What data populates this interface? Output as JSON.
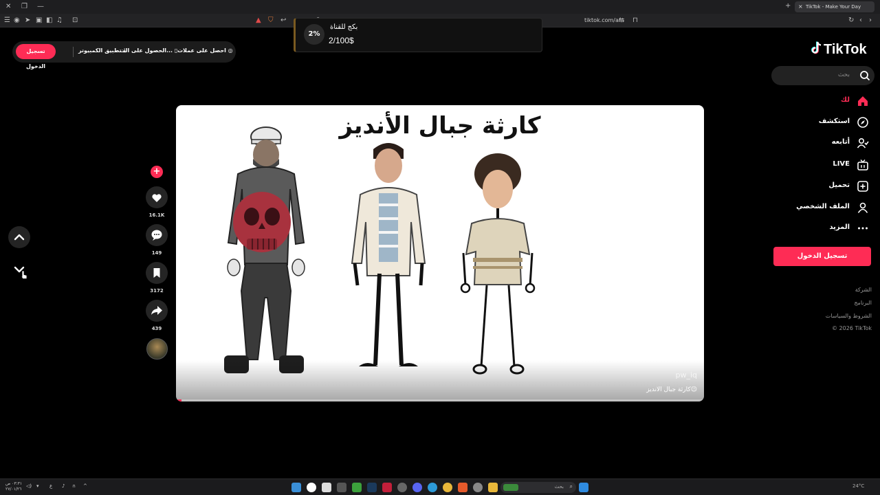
{
  "browser": {
    "tab_title": "TikTok - Make Your Day",
    "url": "tiktok.com/ar/",
    "tab_close": "×",
    "new_tab": "+",
    "window_controls": [
      "✕",
      "❐",
      "—"
    ]
  },
  "download_popup": {
    "percent": "2%",
    "title": "بكج للقناة",
    "amount": "2/100$"
  },
  "topbar": {
    "login": "تسجيل الدخول",
    "desktop_app": "تطبيق الكمبيوتر",
    "get_app": "الحصول على الت...",
    "coins": "احصل على عملات"
  },
  "sidebar": {
    "logo": "TikTok",
    "search_placeholder": "بحث",
    "items": [
      {
        "label": "لك",
        "icon": "home-icon"
      },
      {
        "label": "استكشف",
        "icon": "compass-icon"
      },
      {
        "label": "أتابعه",
        "icon": "user-follow-icon"
      },
      {
        "label": "LIVE",
        "icon": "live-tv-icon"
      },
      {
        "label": "تحميل",
        "icon": "upload-icon"
      },
      {
        "label": "الملف الشخصي",
        "icon": "profile-icon"
      },
      {
        "label": "المزيد",
        "icon": "more-icon"
      }
    ],
    "login_button": "تسجيل الدخول",
    "footer": [
      "الشركة",
      "البرنامج",
      "الشروط والسياسات",
      "© 2026 TikTok"
    ]
  },
  "video": {
    "headline": "كارثة جبال الأنديز",
    "username": "pw_iq",
    "caption": "كارثة جبال الانديز😉",
    "progress": 0.01
  },
  "actions": {
    "likes": "16.1K",
    "comments": "149",
    "saves": "3172",
    "shares": "439"
  },
  "taskbar": {
    "search_placeholder": "بحث",
    "lang": "ع",
    "time": "٠٣:٣١ ص",
    "date": "٢٧/٠١/٢٦",
    "weather": "24°C"
  },
  "colors": {
    "accent": "#fe2c55",
    "background": "#000000"
  }
}
